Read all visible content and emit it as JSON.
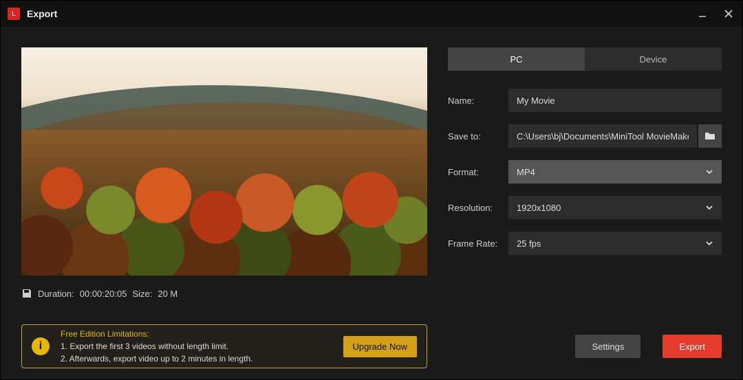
{
  "titlebar": {
    "title": "Export"
  },
  "tabs": {
    "pc": "PC",
    "device": "Device"
  },
  "form": {
    "name_label": "Name:",
    "name_value": "My Movie",
    "saveto_label": "Save to:",
    "saveto_value": "C:\\Users\\bj\\Documents\\MiniTool MovieMaker\\outp",
    "format_label": "Format:",
    "format_value": "MP4",
    "resolution_label": "Resolution:",
    "resolution_value": "1920x1080",
    "framerate_label": "Frame Rate:",
    "framerate_value": "25 fps"
  },
  "meta": {
    "duration_label": "Duration:",
    "duration_value": "00:00:20:05",
    "size_label": "Size:",
    "size_value": "20 M"
  },
  "limitations": {
    "title": "Free Edition Limitations:",
    "line1": "1. Export the first 3 videos without length limit.",
    "line2": "2. Afterwards, export video up to 2 minutes in length.",
    "upgrade": "Upgrade Now"
  },
  "footer": {
    "settings": "Settings",
    "export": "Export"
  }
}
